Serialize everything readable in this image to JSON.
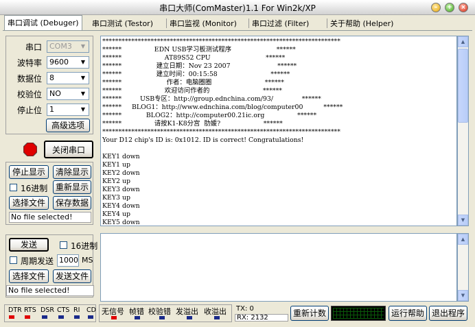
{
  "window": {
    "title": "串口大师(ComMaster)1.1 For Win2k/XP"
  },
  "tabs": [
    {
      "label": "串口调试 (Debuger)"
    },
    {
      "label": "串口测试 (Testor)"
    },
    {
      "label": "串口监视 (Monitor)"
    },
    {
      "label": "串口过滤 (Filter)"
    },
    {
      "label": "关于帮助 (Helper)"
    }
  ],
  "settings": {
    "port_label": "串口",
    "port_value": "COM3",
    "baud_label": "波特率",
    "baud_value": "9600",
    "databits_label": "数据位",
    "databits_value": "8",
    "parity_label": "校验位",
    "parity_value": "NO",
    "stopbits_label": "停止位",
    "stopbits_value": "1",
    "advanced_label": "高级选项"
  },
  "port_control": {
    "close_label": "关闭串口",
    "status_color": "#e00000"
  },
  "receive": {
    "stop_display": "停止显示",
    "clear_display": "清除显示",
    "hex_label": "16进制",
    "redisplay": "重新显示",
    "choose_file": "选择文件",
    "save_data": "保存数据",
    "file_status": "No file selected!"
  },
  "terminal_text": "**************************************************************************\n******                EDN USB学习板测试程序                      ******\n******                     AT89S52 CPU                           ******\n******                 建立日期：Nov 23 2007                       ******\n******                 建立时间：00:15:58                          ******\n******                      作者：电脑圈圈                          ******\n******                     欢迎访问作者的                          ******\n******         USB专区：http://group.ednchina.com/93/              ******\n******     BLOG1：http://www.ednchina.com/blog/computer00          ******\n******            BLOG2：http://computer00.21ic.org                ******\n******                请按K1-K8分宫  肋媛?                     ******\n**************************************************************************\nYour D12 chip's ID is: 0x1012. ID is correct! Congratulations!\n\nKEY1 down\nKEY1 up\nKEY2 down\nKEY2 up\nKEY3 down\nKEY3 up\nKEY4 down\nKEY4 up\nKEY5 down",
  "send": {
    "send_label": "发送",
    "hex_label": "16进制",
    "periodic_label": "周期发送",
    "period_value": "1000",
    "period_unit": "MS",
    "choose_file": "选择文件",
    "send_file": "发送文件",
    "file_status": "No file selected!"
  },
  "status": {
    "signals": [
      "DTR",
      "RTS",
      "DSR",
      "CTS",
      "RI",
      "CD"
    ],
    "signal_colors": [
      "#e00000",
      "#e00000",
      "#1a2a8a",
      "#1a2a8a",
      "#1a2a8a",
      "#1a2a8a"
    ],
    "errors": [
      "无信号",
      "帧错",
      "校验错",
      "发溢出",
      "收溢出"
    ],
    "error_colors": [
      "#e00000",
      "#1a2a8a",
      "#1a2a8a",
      "#1a2a8a",
      "#1a2a8a"
    ],
    "tx": "TX: 0",
    "rx": "RX: 2132",
    "reset_count": "重新计数",
    "run_help": "运行帮助",
    "exit": "退出程序"
  }
}
